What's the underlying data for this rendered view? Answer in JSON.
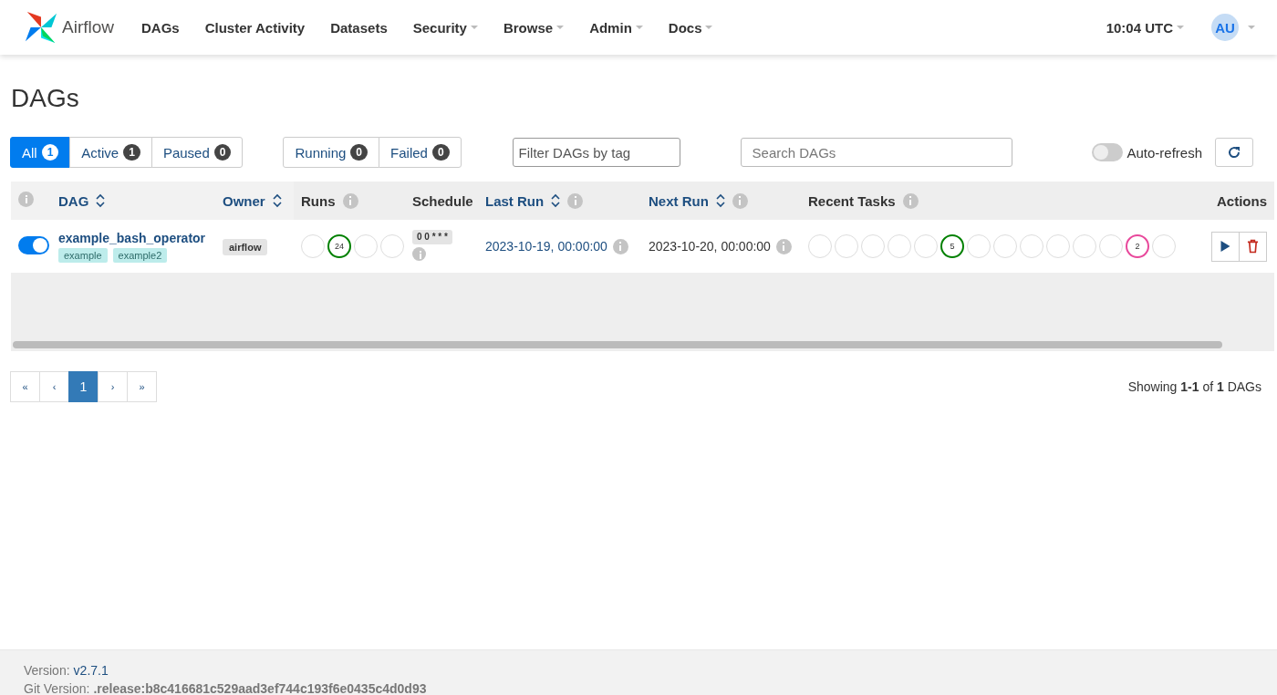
{
  "navbar": {
    "brand": "Airflow",
    "menu": [
      {
        "label": "DAGs",
        "dropdown": false
      },
      {
        "label": "Cluster Activity",
        "dropdown": false
      },
      {
        "label": "Datasets",
        "dropdown": false
      },
      {
        "label": "Security",
        "dropdown": true
      },
      {
        "label": "Browse",
        "dropdown": true
      },
      {
        "label": "Admin",
        "dropdown": true
      },
      {
        "label": "Docs",
        "dropdown": true
      }
    ],
    "clock": {
      "label": "10:04 UTC",
      "dropdown": true
    },
    "user": {
      "initials": "AU",
      "dropdown": true
    }
  },
  "title": "DAGs",
  "status_filters": [
    {
      "label": "All",
      "count": "1",
      "selected": true
    },
    {
      "label": "Active",
      "count": "1",
      "selected": false
    },
    {
      "label": "Paused",
      "count": "0",
      "selected": false
    }
  ],
  "run_filters": [
    {
      "label": "Running",
      "count": "0",
      "selected": false
    },
    {
      "label": "Failed",
      "count": "0",
      "selected": false
    }
  ],
  "tag_filter": {
    "placeholder": "Filter DAGs by tag"
  },
  "search": {
    "placeholder": "Search DAGs"
  },
  "auto_refresh": {
    "label": "Auto-refresh",
    "on": false
  },
  "table": {
    "columns": [
      {
        "sortable": false,
        "info": true
      },
      {
        "label": "DAG",
        "sortable": true,
        "info": false
      },
      {
        "label": "Owner",
        "sortable": true,
        "info": false
      },
      {
        "label": "Runs",
        "sortable": false,
        "info": true
      },
      {
        "label": "Schedule",
        "sortable": false,
        "info": false
      },
      {
        "label": "Last Run",
        "sortable": true,
        "info": true
      },
      {
        "label": "Next Run",
        "sortable": true,
        "info": true
      },
      {
        "label": "Recent Tasks",
        "sortable": false,
        "info": true
      },
      {
        "label": "Actions",
        "sortable": false,
        "info": false
      }
    ],
    "rows": [
      {
        "on": true,
        "name": "example_bash_operator",
        "tags": [
          "example",
          "example2"
        ],
        "owner": "airflow",
        "runs": [
          {
            "kind": "empty"
          },
          {
            "kind": "count",
            "count": "24",
            "color": "#008000"
          },
          {
            "kind": "empty"
          },
          {
            "kind": "empty"
          }
        ],
        "schedule": "0 0 * * *",
        "last_run": "2023-10-19, 00:00:00",
        "next_run": "2023-10-20, 00:00:00",
        "recent_tasks": [
          {
            "kind": "empty"
          },
          {
            "kind": "empty"
          },
          {
            "kind": "empty"
          },
          {
            "kind": "empty"
          },
          {
            "kind": "empty"
          },
          {
            "kind": "count",
            "count": "5",
            "color": "#008000"
          },
          {
            "kind": "empty"
          },
          {
            "kind": "empty"
          },
          {
            "kind": "empty"
          },
          {
            "kind": "empty"
          },
          {
            "kind": "empty"
          },
          {
            "kind": "empty"
          },
          {
            "kind": "count",
            "count": "2",
            "color": "#e8489b"
          },
          {
            "kind": "empty"
          }
        ]
      }
    ]
  },
  "pagination": [
    {
      "label": "«",
      "selected": false
    },
    {
      "label": "‹",
      "selected": false
    },
    {
      "label": "1",
      "selected": true
    },
    {
      "label": "›",
      "selected": false
    },
    {
      "label": "»",
      "selected": false
    }
  ],
  "showing": "Showing **1-1** of **1** DAGs",
  "footer": {
    "version_label": "Version:",
    "version": "v2.7.1",
    "git_label": "Git Version:",
    "git": ".release:b8c416681c529aad3ef744c193f6e0435c4d0d93"
  }
}
